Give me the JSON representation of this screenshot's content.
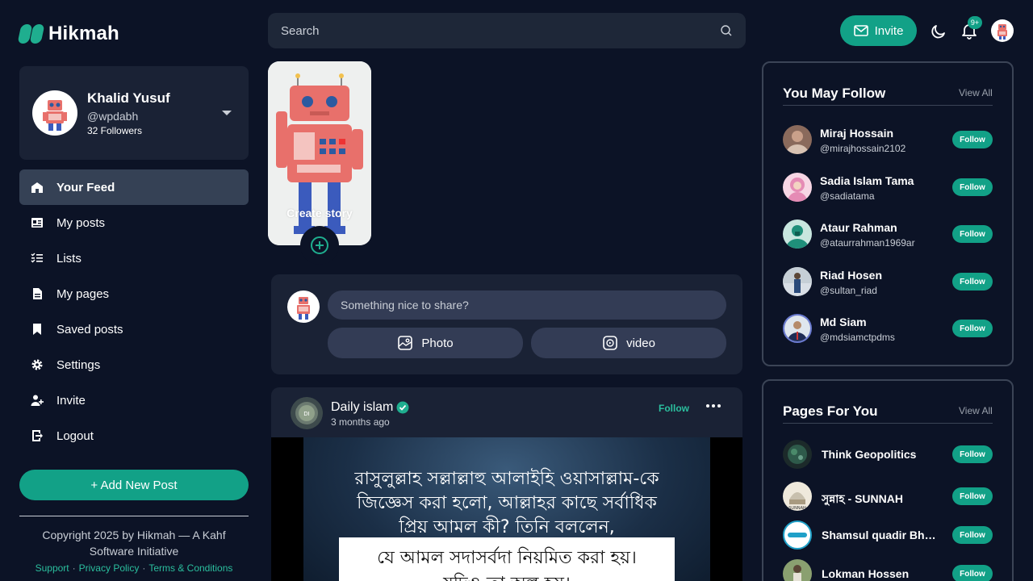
{
  "brand": {
    "name": "Hikmah",
    "accent": "#12a187"
  },
  "search": {
    "placeholder": "Search"
  },
  "topbar": {
    "invite_label": "Invite",
    "notification_badge": "9+"
  },
  "profile": {
    "name": "Khalid Yusuf",
    "handle": "@wpdabh",
    "followers": "32 Followers"
  },
  "nav": {
    "items": [
      {
        "label": "Your Feed",
        "icon": "home-icon",
        "active": true
      },
      {
        "label": "My posts",
        "icon": "newspaper-icon"
      },
      {
        "label": "Lists",
        "icon": "list-icon"
      },
      {
        "label": "My pages",
        "icon": "document-icon"
      },
      {
        "label": "Saved posts",
        "icon": "bookmark-icon"
      },
      {
        "label": "Settings",
        "icon": "gear-icon"
      },
      {
        "label": "Invite",
        "icon": "user-plus-icon"
      },
      {
        "label": "Logout",
        "icon": "logout-icon"
      }
    ]
  },
  "add_post_label": "+ Add New Post",
  "footer": {
    "copyright": "Copyright 2025 by Hikmah — A Kahf Software Initiative",
    "links": [
      "Support",
      "Privacy Policy",
      "Terms & Conditions"
    ]
  },
  "story": {
    "create_label": "Create story"
  },
  "composer": {
    "placeholder": "Something nice to share?",
    "photo_label": "Photo",
    "video_label": "video"
  },
  "post": {
    "author": "Daily islam",
    "time": "3 months ago",
    "follow_label": "Follow",
    "image_lines": [
      "রাসুলুল্লাহ সল্লাল্লাহু আলাইহি ওয়াসাল্লাম-কে",
      "জিজ্ঞেস করা হলো, আল্লাহর কাছে সর্বাধিক",
      "প্রিয় আমল কী? তিনি বললেন,"
    ],
    "image_highlight": "যে আমল সদাসর্বদা নিয়মিত করা হয়।",
    "image_highlight_2": "যদিও তা অল্প হয়।"
  },
  "you_may_follow": {
    "title": "You May Follow",
    "view_all": "View All",
    "follow_label": "Follow",
    "people": [
      {
        "name": "Miraj Hossain",
        "handle": "@mirajhossain2102"
      },
      {
        "name": "Sadia Islam Tama",
        "handle": "@sadiatama"
      },
      {
        "name": "Ataur Rahman",
        "handle": "@ataurrahman1969ar"
      },
      {
        "name": "Riad Hosen",
        "handle": "@sultan_riad"
      },
      {
        "name": "Md Siam",
        "handle": "@mdsiamctpdms"
      }
    ]
  },
  "pages_for_you": {
    "title": "Pages For You",
    "view_all": "View All",
    "follow_label": "Follow",
    "pages": [
      {
        "name": "Think Geopolitics"
      },
      {
        "name": "সুন্নাহ - SUNNAH"
      },
      {
        "name": "Shamsul quadir Bhuiyan"
      },
      {
        "name": "Lokman Hossen"
      }
    ]
  }
}
